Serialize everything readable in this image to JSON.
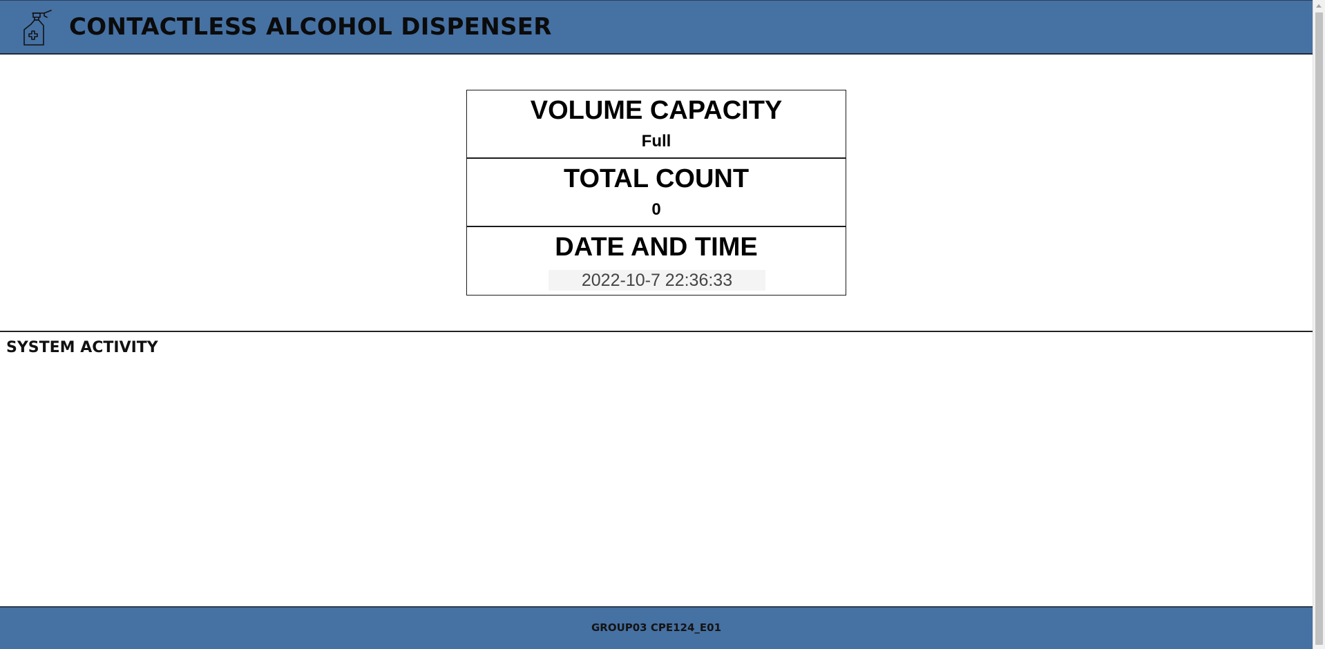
{
  "header": {
    "title": "CONTACTLESS ALCOHOL DISPENSER",
    "logo_icon": "sanitizer-spray-bottle-icon"
  },
  "stats": {
    "volume": {
      "label": "VOLUME CAPACITY",
      "value": "Full"
    },
    "count": {
      "label": "TOTAL COUNT",
      "value": "0"
    },
    "datetime": {
      "label": "DATE AND TIME",
      "value": "2022-10-7 22:36:33"
    }
  },
  "activity": {
    "title": "SYSTEM ACTIVITY"
  },
  "footer": {
    "text": "GROUP03 CPE124_E01"
  },
  "colors": {
    "header_bg": "#4671a3",
    "footer_bg": "#4671a3"
  }
}
